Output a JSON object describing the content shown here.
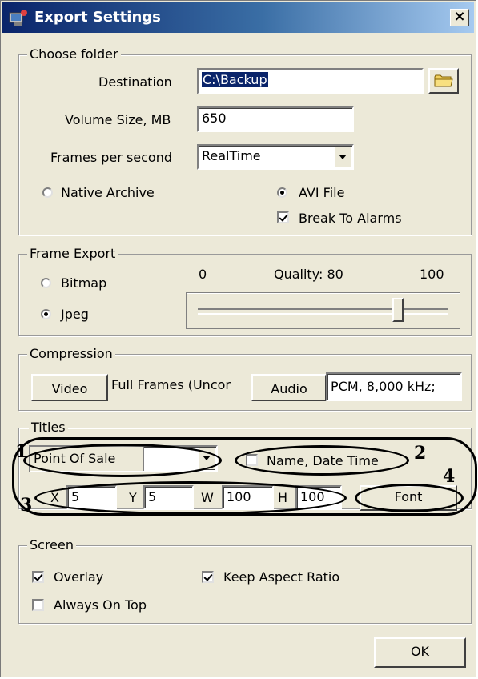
{
  "window": {
    "title": "Export Settings",
    "close_label": "×"
  },
  "choose_folder": {
    "legend": "Choose folder",
    "destination_label": "Destination",
    "destination_value": "C:\\Backup",
    "volume_label": "Volume Size, MB",
    "volume_value": "650",
    "fps_label": "Frames per second",
    "fps_value": "RealTime",
    "native_archive_label": "Native Archive",
    "avi_file_label": "AVI File",
    "break_to_alarms_label": "Break To Alarms",
    "selected_format": "AVI File",
    "break_to_alarms_checked": true
  },
  "frame_export": {
    "legend": "Frame Export",
    "bitmap_label": "Bitmap",
    "jpeg_label": "Jpeg",
    "selected": "Jpeg",
    "quality_min": "0",
    "quality_label": "Quality: 80",
    "quality_max": "100",
    "quality_value": 80
  },
  "compression": {
    "legend": "Compression",
    "video_button": "Video",
    "video_value": "Full Frames (Uncor",
    "audio_button": "Audio",
    "audio_value": "PCM, 8,000 kHz;"
  },
  "titles": {
    "legend": "Titles",
    "source_value": "Point Of Sale",
    "name_date_time_label": "Name, Date Time",
    "name_date_time_checked": false,
    "x_label": "X",
    "x_value": "5",
    "y_label": "Y",
    "y_value": "5",
    "w_label": "W",
    "w_value": "100",
    "h_label": "H",
    "h_value": "100",
    "font_button": "Font",
    "annotations": [
      "1",
      "2",
      "3",
      "4"
    ]
  },
  "screen": {
    "legend": "Screen",
    "overlay_label": "Overlay",
    "overlay_checked": true,
    "always_on_top_label": "Always On Top",
    "always_on_top_checked": false,
    "keep_aspect_label": "Keep Aspect Ratio",
    "keep_aspect_checked": true
  },
  "ok_button": "OK"
}
